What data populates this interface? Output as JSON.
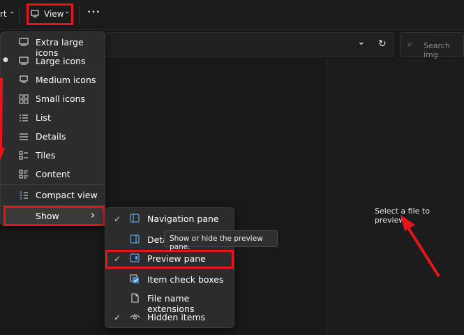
{
  "toolbar": {
    "sort_partial": "rt",
    "sort_chevron": "⌄",
    "view_label": "View",
    "view_chevron": "⌄",
    "more_label": "•••"
  },
  "address_bar": {
    "chevron": "⌄",
    "refresh": "↻"
  },
  "search": {
    "placeholder": "Search img",
    "icon": "⌕"
  },
  "preview_pane": {
    "message": "Select a file to preview."
  },
  "view_menu": {
    "items": [
      {
        "label": "Extra large icons",
        "icon": "monitor-icon",
        "selected": false
      },
      {
        "label": "Large icons",
        "icon": "monitor-icon",
        "selected": true
      },
      {
        "label": "Medium icons",
        "icon": "monitor-small-icon",
        "selected": false
      },
      {
        "label": "Small icons",
        "icon": "grid-icon",
        "selected": false
      },
      {
        "label": "List",
        "icon": "list-icon",
        "selected": false
      },
      {
        "label": "Details",
        "icon": "details-icon",
        "selected": false
      },
      {
        "label": "Tiles",
        "icon": "tiles-icon",
        "selected": false
      },
      {
        "label": "Content",
        "icon": "content-icon",
        "selected": false
      },
      {
        "label": "Compact view",
        "icon": "compact-view-icon",
        "selected": false
      }
    ],
    "show_label": "Show",
    "show_chevron": "›"
  },
  "show_submenu": {
    "items": [
      {
        "label": "Navigation pane",
        "checked": true,
        "icon": "navigation-pane-icon"
      },
      {
        "label": "Deta",
        "checked": false,
        "icon": "details-pane-icon"
      },
      {
        "label": "Preview pane",
        "checked": true,
        "icon": "preview-pane-icon"
      },
      {
        "label": "Item check boxes",
        "checked": false,
        "icon": "checkbox-icon"
      },
      {
        "label": "File name extensions",
        "checked": false,
        "icon": "file-icon"
      },
      {
        "label": "Hidden items",
        "checked": true,
        "icon": "eye-icon"
      }
    ],
    "check_glyph": "✓"
  },
  "tooltip": {
    "text": "Show or hide the preview pane."
  },
  "colors": {
    "highlight": "#e8141c",
    "accent_blue": "#5aa7e6",
    "background": "#191919"
  }
}
